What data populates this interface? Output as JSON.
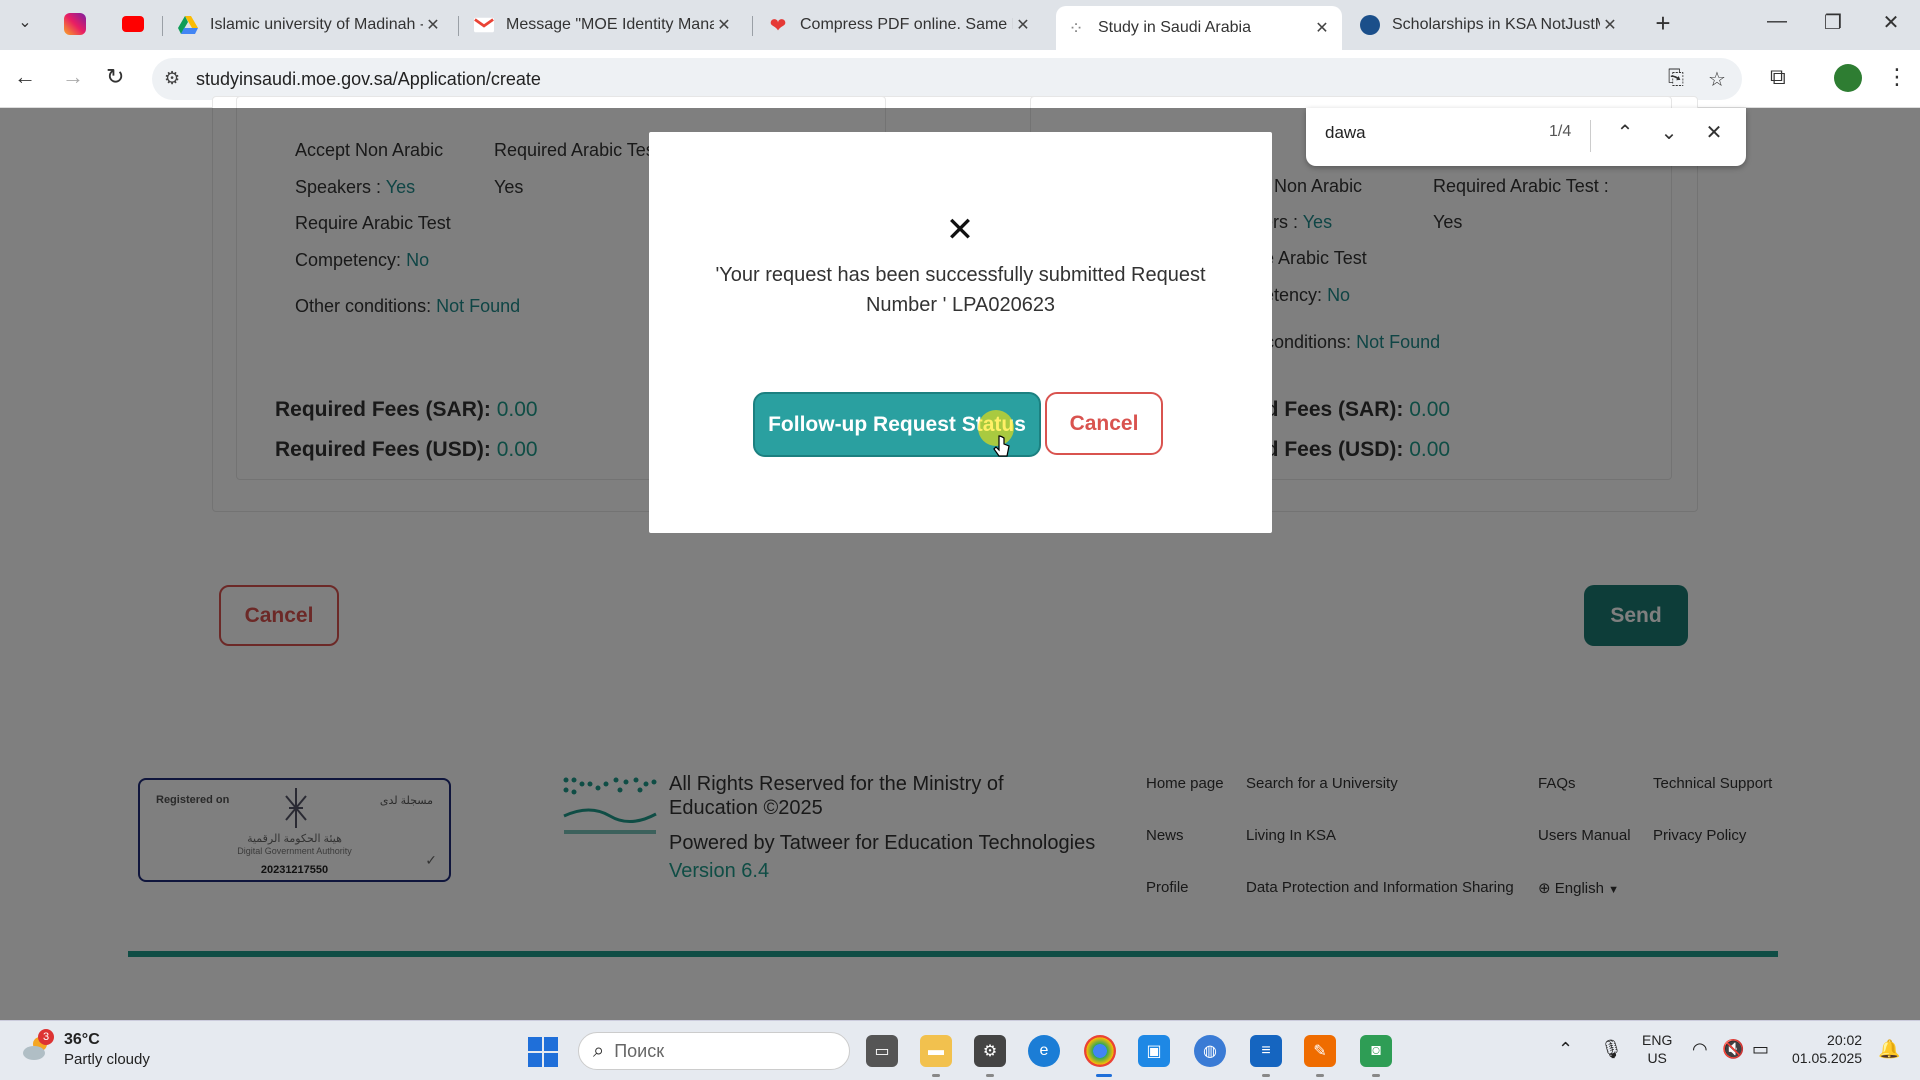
{
  "browser": {
    "tabs": [
      {
        "title": "Islamic university of Madinah -",
        "favicon": "google-drive-icon"
      },
      {
        "title": "Message \"MOE Identity Manag",
        "favicon": "gmail-icon"
      },
      {
        "title": "Compress PDF online. Same PD",
        "favicon": "heart-icon"
      },
      {
        "title": "Study in Saudi Arabia",
        "favicon": "loading-icon",
        "active": true
      },
      {
        "title": "Scholarships in KSA NotJustMa",
        "favicon": "site-icon"
      }
    ],
    "url": "studyinsaudi.moe.gov.sa/Application/create"
  },
  "find_bar": {
    "query": "dawa",
    "count": "1/4"
  },
  "left_card": {
    "accept_label": "Accept Non Arabic",
    "speakers_label": "Speakers :",
    "speakers_value": "Yes",
    "req_test_label": "Required Arabic Test :",
    "req_test_value": "Yes",
    "require_label": "Require Arabic Test",
    "competency_label": "Competency:",
    "competency_value": "No",
    "other_label": "Other conditions:",
    "other_value": "Not Found",
    "fees_sar_label": "Required Fees (SAR):",
    "fees_sar_value": "0.00",
    "fees_usd_label": "Required Fees (USD):",
    "fees_usd_value": "0.00"
  },
  "right_card": {
    "accept_label": "pt Non Arabic",
    "speakers_label": "kers :",
    "speakers_value": "Yes",
    "req_test_label": "Required Arabic Test :",
    "req_test_value": "Yes",
    "require_label": "ire Arabic Test",
    "competency_label": "petency:",
    "competency_value": "No",
    "other_label": "r conditions:",
    "other_value": "Not Found",
    "fees_sar_label": "ed Fees (SAR):",
    "fees_sar_value": "0.00",
    "fees_usd_label": "ed Fees (USD):",
    "fees_usd_value": "0.00"
  },
  "page_buttons": {
    "cancel": "Cancel",
    "send": "Send"
  },
  "modal": {
    "message": "'Your request has been successfully submitted Request Number ' LPA020623",
    "follow_up": "Follow-up Request Status",
    "cancel": "Cancel"
  },
  "footer": {
    "badge_registered": "Registered on",
    "badge_registered_ar": "مسجلة لدى",
    "badge_authority_ar": "هيئة الحكومة الرقمية",
    "badge_authority": "Digital Government Authority",
    "badge_number": "20231217550",
    "rights": "All Rights Reserved for the Ministry of Education ©2025",
    "powered": "Powered by Tatweer for Education Technologies",
    "version": "Version 6.4",
    "links": {
      "home": "Home page",
      "search": "Search for a University",
      "faqs": "FAQs",
      "support": "Technical Support",
      "news": "News",
      "living": "Living In KSA",
      "manual": "Users Manual",
      "privacy": "Privacy Policy",
      "profile": "Profile",
      "data_protection": "Data Protection and Information Sharing",
      "language": "English"
    },
    "accent_color": "#1f9a8a"
  },
  "taskbar": {
    "weather_temp": "36°C",
    "weather_desc": "Partly cloudy",
    "weather_badge": "3",
    "search_placeholder": "Поиск",
    "lang_line1": "ENG",
    "lang_line2": "US",
    "time": "20:02",
    "date": "01.05.2025"
  }
}
